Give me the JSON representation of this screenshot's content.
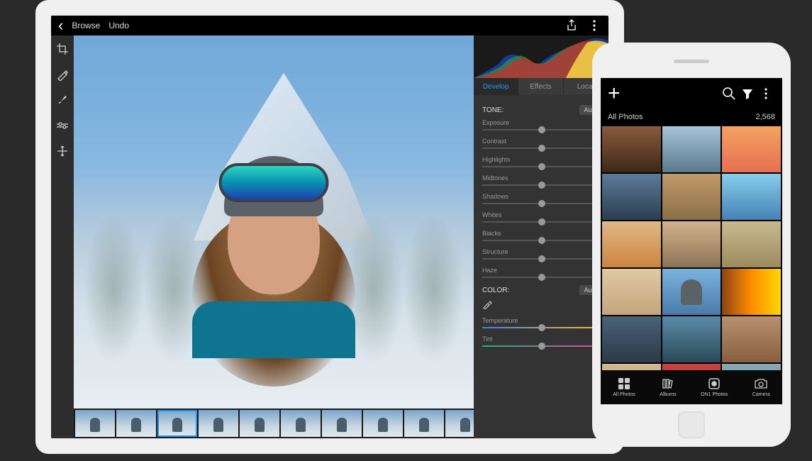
{
  "tablet": {
    "header": {
      "browse": "Browse",
      "undo": "Undo"
    },
    "tabs": {
      "develop": "Develop",
      "effects": "Effects",
      "local": "Local"
    },
    "tone": {
      "title": "TONE:",
      "auto": "Auto",
      "sliders": {
        "exposure": "Exposure",
        "contrast": "Contrast",
        "highlights": "Highlights",
        "midtones": "Midtones",
        "shadows": "Shadows",
        "whites": "Whites",
        "blacks": "Blacks",
        "structure": "Structure",
        "haze": "Haze"
      }
    },
    "color": {
      "title": "COLOR:",
      "auto": "Auto",
      "sliders": {
        "temperature": "Temperature",
        "tint": "Tint"
      }
    }
  },
  "phone": {
    "subheader": {
      "title": "All Photos",
      "count": "2,568"
    },
    "tabbar": {
      "all": "All Photos",
      "albums": "Albums",
      "on1": "ON1 Photos",
      "camera": "Camera"
    }
  }
}
